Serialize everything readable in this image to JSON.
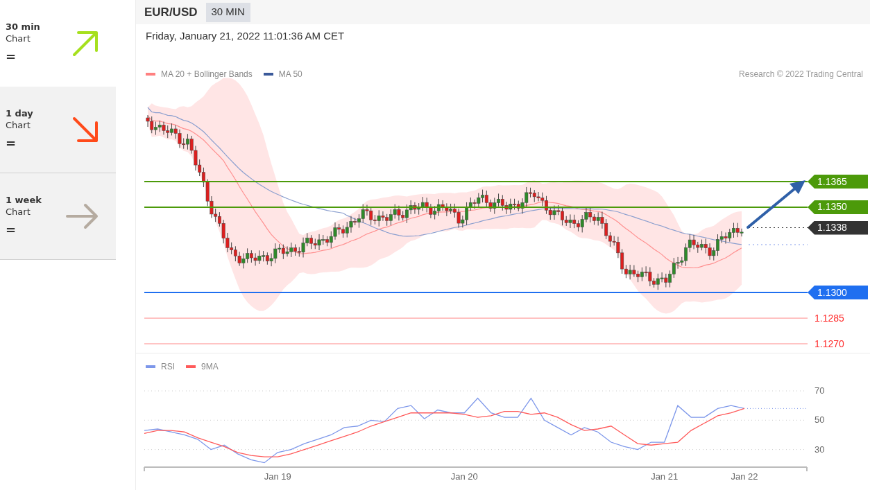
{
  "sidebar": {
    "items": [
      {
        "period": "30 min",
        "label": "Chart",
        "sign": "=",
        "kind": "up",
        "color": "#a6e01e",
        "selected": true
      },
      {
        "period": "1 day",
        "label": "Chart",
        "sign": "=",
        "kind": "down",
        "color": "#ff4a1a",
        "selected": false
      },
      {
        "period": "1 week",
        "label": "Chart",
        "sign": "=",
        "kind": "flat",
        "color": "#b5aba0",
        "selected": false
      }
    ]
  },
  "header": {
    "symbol": "EUR/USD",
    "timeframe": "30 MIN"
  },
  "timestamp": "Friday, January 21, 2022 11:01:36 AM CET",
  "price_chart": {
    "legend": [
      {
        "name": "MA 20 + Bollinger Bands",
        "color": "#ff8080"
      },
      {
        "name": "MA 50",
        "color": "#3b5a9a"
      }
    ],
    "credit": "Research © 2022 Trading Central",
    "levels": [
      {
        "value": "1.1365",
        "kind": "tag",
        "color": "#4c9a0a"
      },
      {
        "value": "1.1350",
        "kind": "tag",
        "color": "#4c9a0a"
      },
      {
        "value": "1.1338",
        "kind": "current",
        "color": "#333333"
      },
      {
        "value": "1.1300",
        "kind": "tag",
        "color": "#1f6ff0"
      },
      {
        "value": "1.1285",
        "kind": "text",
        "color": "#ff2a2a"
      },
      {
        "value": "1.1270",
        "kind": "text",
        "color": "#ff2a2a"
      }
    ]
  },
  "rsi_chart": {
    "chart_data": {
      "type": "line",
      "categories": [
        null,
        null,
        null,
        null,
        null,
        null,
        null,
        null,
        null,
        null,
        "Jan 19",
        null,
        null,
        null,
        null,
        null,
        null,
        null,
        null,
        null,
        null,
        null,
        null,
        null,
        "Jan 20",
        null,
        null,
        null,
        null,
        null,
        null,
        null,
        null,
        null,
        null,
        null,
        null,
        null,
        null,
        "Jan 21",
        null,
        null,
        null,
        null,
        null,
        "Jan 22"
      ],
      "series": [
        {
          "name": "RSI",
          "color": "#7d97ea",
          "values": [
            43,
            44,
            42,
            40,
            37,
            30,
            33,
            27,
            23,
            21,
            28,
            30,
            34,
            37,
            40,
            45,
            46,
            50,
            49,
            58,
            60,
            51,
            57,
            55,
            55,
            65,
            55,
            52,
            52,
            65,
            50,
            45,
            40,
            45,
            42,
            35,
            32,
            30,
            35,
            35,
            60,
            52,
            52,
            58,
            60,
            58
          ]
        },
        {
          "name": "9MA",
          "color": "#ff5a5a",
          "values": [
            41,
            43,
            43,
            42,
            38,
            35,
            32,
            28,
            26,
            25,
            25,
            27,
            30,
            33,
            36,
            39,
            42,
            46,
            49,
            52,
            55,
            55,
            55,
            55,
            54,
            52,
            53,
            56,
            56,
            54,
            55,
            52,
            47,
            43,
            44,
            46,
            40,
            34,
            33,
            34,
            35,
            43,
            48,
            53,
            55,
            58
          ]
        }
      ],
      "ylim": [
        18,
        70
      ],
      "yticks": [
        30,
        50,
        70
      ],
      "grid": true
    }
  }
}
